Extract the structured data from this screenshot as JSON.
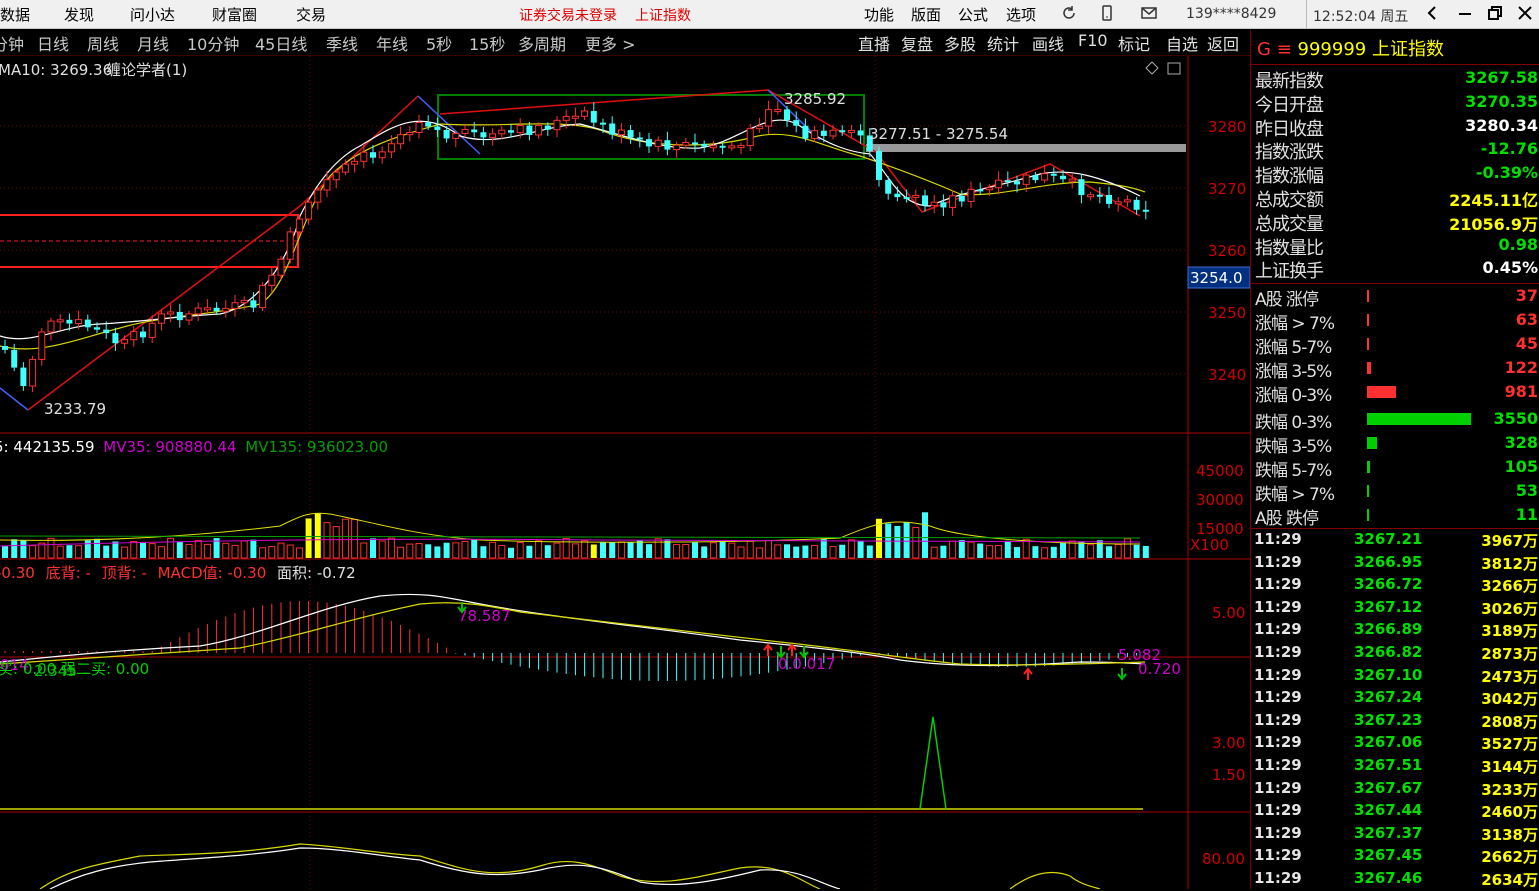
{
  "menubar": {
    "items": [
      "数据",
      "发现",
      "问小达",
      "财富圈",
      "交易"
    ],
    "warning": "证券交易未登录",
    "index_name": "上证指数",
    "right_items": [
      "功能",
      "版面",
      "公式",
      "选项"
    ],
    "phone": "139****8429",
    "clock": "12:52:04 周五"
  },
  "periodbar": {
    "periods": [
      "分钟",
      "日线",
      "周线",
      "月线",
      "10分钟",
      "45日线",
      "季线",
      "年线",
      "5秒",
      "15秒",
      "多周期",
      "更多 >"
    ],
    "tools": [
      "直播",
      "复盘",
      "多股",
      "统计",
      "画线",
      "F10",
      "标记",
      "自选",
      "返回"
    ]
  },
  "chart": {
    "ma_legend": "MA10: 3269.36",
    "indicator_name": "缠论学者(1)",
    "price_axis": [
      "3280",
      "3270",
      "3260",
      "3250",
      "3240"
    ],
    "current_price_tag": "3254.0",
    "high_label": "3285.92",
    "low_label": "3233.79",
    "range_label": "3277.51 - 3275.54",
    "volume_legend": {
      "mv5": "5: 442135.59",
      "mv35": "MV35: 908880.44",
      "mv135": "MV135: 936023.00"
    },
    "volume_axis": [
      "45000",
      "30000",
      "15000"
    ],
    "volume_unit": "X100",
    "macd_legend": {
      "a": "-0.30",
      "b": "底背: -",
      "c": "顶背: -",
      "d": "MACD值: -0.30",
      "e": "面积: -0.72"
    },
    "macd_axis": "5.00",
    "macd_labels": [
      "78.587",
      "2.345",
      "014",
      "0.0.017",
      "5.082",
      "0.720"
    ],
    "buy_legend": "买: 0.00  强二买: 0.00",
    "buy_axis": [
      "3.00",
      "1.50"
    ],
    "osc_axis": "80.00"
  },
  "quote": {
    "code": "999999",
    "name": "上证指数",
    "stats": [
      {
        "label": "最新指数",
        "value": "3267.58",
        "color": "#00e000"
      },
      {
        "label": "今日开盘",
        "value": "3270.35",
        "color": "#00e000"
      },
      {
        "label": "昨日收盘",
        "value": "3280.34",
        "color": "#ffffff"
      },
      {
        "label": "指数涨跌",
        "value": "-12.76",
        "color": "#00e000"
      },
      {
        "label": "指数涨幅",
        "value": "-0.39%",
        "color": "#00e000"
      },
      {
        "label": "总成交额",
        "value": "2245.11亿",
        "color": "#ffff00"
      },
      {
        "label": "总成交量",
        "value": "21056.9万",
        "color": "#ffff00"
      },
      {
        "label": "指数量比",
        "value": "0.98",
        "color": "#00e000"
      },
      {
        "label": "上证换手",
        "value": "0.45%",
        "color": "#ffffff"
      }
    ],
    "breadth_up": [
      {
        "label": "A股 涨停",
        "value": "37",
        "pct": 0.01
      },
      {
        "label": "涨幅 > 7%",
        "value": "63",
        "pct": 0.018
      },
      {
        "label": "涨幅 5-7%",
        "value": "45",
        "pct": 0.013
      },
      {
        "label": "涨幅 3-5%",
        "value": "122",
        "pct": 0.035
      },
      {
        "label": "涨幅 0-3%",
        "value": "981",
        "pct": 0.28
      }
    ],
    "breadth_down": [
      {
        "label": "跌幅 0-3%",
        "value": "3550",
        "pct": 1.0
      },
      {
        "label": "跌幅 3-5%",
        "value": "328",
        "pct": 0.092
      },
      {
        "label": "跌幅 5-7%",
        "value": "105",
        "pct": 0.03
      },
      {
        "label": "跌幅 > 7%",
        "value": "53",
        "pct": 0.015
      },
      {
        "label": "A股 跌停",
        "value": "11",
        "pct": 0.005
      }
    ],
    "ticks": [
      {
        "t": "11:29",
        "p": "3267.21",
        "v": "3967万"
      },
      {
        "t": "11:29",
        "p": "3266.95",
        "v": "3812万"
      },
      {
        "t": "11:29",
        "p": "3266.72",
        "v": "3266万"
      },
      {
        "t": "11:29",
        "p": "3267.12",
        "v": "3026万"
      },
      {
        "t": "11:29",
        "p": "3266.89",
        "v": "3189万"
      },
      {
        "t": "11:29",
        "p": "3266.82",
        "v": "2873万"
      },
      {
        "t": "11:29",
        "p": "3267.10",
        "v": "2473万"
      },
      {
        "t": "11:29",
        "p": "3267.24",
        "v": "3042万"
      },
      {
        "t": "11:29",
        "p": "3267.23",
        "v": "2808万"
      },
      {
        "t": "11:29",
        "p": "3267.06",
        "v": "3527万"
      },
      {
        "t": "11:29",
        "p": "3267.51",
        "v": "3144万"
      },
      {
        "t": "11:29",
        "p": "3267.67",
        "v": "3233万"
      },
      {
        "t": "11:29",
        "p": "3267.44",
        "v": "2460万"
      },
      {
        "t": "11:29",
        "p": "3267.37",
        "v": "3138万"
      },
      {
        "t": "11:29",
        "p": "3267.45",
        "v": "2662万"
      },
      {
        "t": "11:29",
        "p": "3267.46",
        "v": "2634万"
      }
    ]
  }
}
